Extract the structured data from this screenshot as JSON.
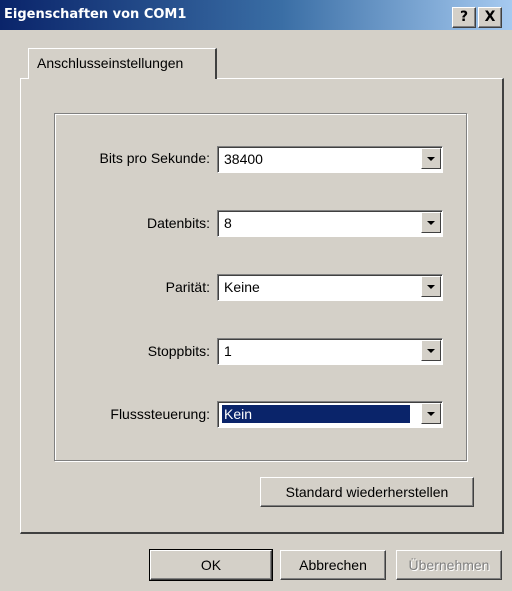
{
  "window": {
    "title": "Eigenschaften von COM1",
    "help_button": "?",
    "close_button": "X"
  },
  "tabs": [
    {
      "label": "Anschlusseinstellungen",
      "active": true
    }
  ],
  "settings": [
    {
      "label": "Bits pro Sekunde:",
      "value": "38400",
      "focused": false
    },
    {
      "label": "Datenbits:",
      "value": "8",
      "focused": false
    },
    {
      "label": "Parität:",
      "value": "Keine",
      "focused": false
    },
    {
      "label": "Stoppbits:",
      "value": "1",
      "focused": false
    },
    {
      "label": "Flusssteuerung:",
      "value": "Kein",
      "focused": true
    }
  ],
  "buttons": {
    "restore_defaults": "Standard wiederherstellen",
    "ok": "OK",
    "cancel": "Abbrechen",
    "apply": "Übernehmen"
  },
  "colors": {
    "title_bar_start": "#0a246a",
    "title_bar_end": "#a6caf0",
    "face": "#d4d0c8",
    "selection": "#0a246a"
  }
}
